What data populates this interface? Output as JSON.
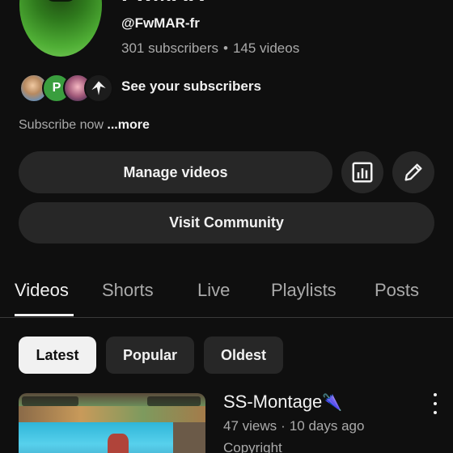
{
  "channel": {
    "name": "FwMAR",
    "handle": "@FwMAR-fr",
    "subscribers": "301 subscribers",
    "separator": "•",
    "videos_count": "145 videos",
    "see_subscribers": "See your subscribers",
    "subscriber_avatar_letter": "P",
    "description": "Subscribe now",
    "more_label": "...more"
  },
  "actions": {
    "manage_videos": "Manage videos",
    "visit_community": "Visit Community",
    "analytics_icon": "analytics-icon",
    "edit_icon": "pencil-icon"
  },
  "tabs": [
    {
      "label": "Videos",
      "active": true
    },
    {
      "label": "Shorts",
      "active": false
    },
    {
      "label": "Live",
      "active": false
    },
    {
      "label": "Playlists",
      "active": false
    },
    {
      "label": "Posts",
      "active": false
    }
  ],
  "filters": [
    {
      "label": "Latest",
      "selected": true
    },
    {
      "label": "Popular",
      "selected": false
    },
    {
      "label": "Oldest",
      "selected": false
    }
  ],
  "videos": [
    {
      "title": "SS-Montage",
      "title_emoji": "🌂",
      "views": "47 views",
      "separator": "·",
      "age": "10 days ago",
      "extra": "Copyright"
    }
  ],
  "colors": {
    "background": "#0f0f0f",
    "surface": "#272727",
    "text_primary": "#f1f1f1",
    "text_secondary": "#aaaaaa",
    "chip_selected_bg": "#f1f1f1"
  }
}
